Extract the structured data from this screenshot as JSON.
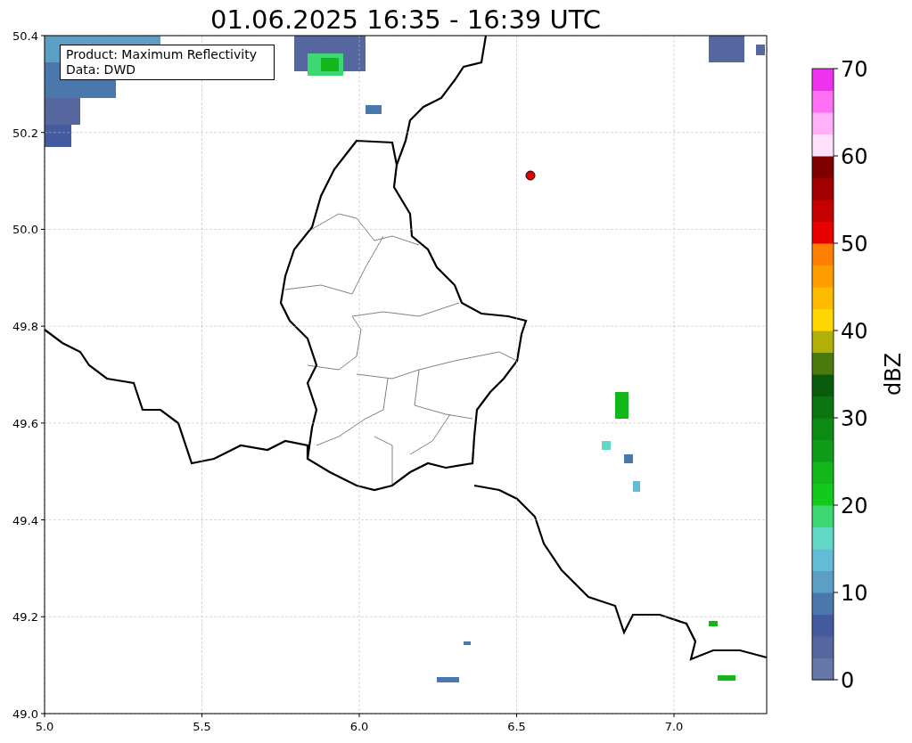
{
  "title": "01.06.2025 16:35 - 16:39 UTC",
  "info_box": [
    "Product: Maximum Reflectivity",
    "Data: DWD"
  ],
  "x_ticks": [
    "5.0",
    "5.5",
    "6.0",
    "6.5",
    "7.0"
  ],
  "y_ticks": [
    "50.4",
    "50.2",
    "50.0",
    "49.8",
    "49.6",
    "49.4",
    "49.2",
    "49.0"
  ],
  "colorbar": {
    "label": "dBZ",
    "ticks": [
      "70",
      "60",
      "50",
      "40",
      "30",
      "20",
      "10",
      "0"
    ],
    "bands": [
      {
        "color": "#6577a8"
      },
      {
        "color": "#56679f"
      },
      {
        "color": "#445c9f"
      },
      {
        "color": "#4a78ad"
      },
      {
        "color": "#5b9ec6"
      },
      {
        "color": "#62bcd8"
      },
      {
        "color": "#62d9c6"
      },
      {
        "color": "#3dd872"
      },
      {
        "color": "#12c91c"
      },
      {
        "color": "#12b71a"
      },
      {
        "color": "#0f9c17"
      },
      {
        "color": "#0d8a14"
      },
      {
        "color": "#0b7511"
      },
      {
        "color": "#0a5c0d"
      },
      {
        "color": "#4a7a0c"
      },
      {
        "color": "#b0b008"
      },
      {
        "color": "#ffd700"
      },
      {
        "color": "#ffbb00"
      },
      {
        "color": "#ff9d00"
      },
      {
        "color": "#ff8000"
      },
      {
        "color": "#e80000"
      },
      {
        "color": "#c40000"
      },
      {
        "color": "#a00000"
      },
      {
        "color": "#800000"
      },
      {
        "color": "#ffe0fa"
      },
      {
        "color": "#ffb0f8"
      },
      {
        "color": "#ff70f5"
      },
      {
        "color": "#ee33ee"
      }
    ]
  }
}
